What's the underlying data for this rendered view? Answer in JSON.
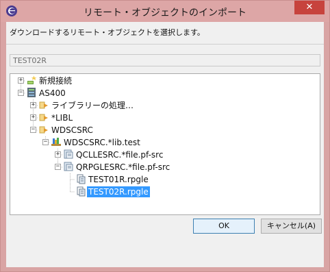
{
  "window": {
    "title": "リモート・オブジェクトのインポート",
    "close_glyph": "✕"
  },
  "dialog": {
    "instruction": "ダウンロードするリモート・オブジェクトを選択します。",
    "filter_value": "TEST02R"
  },
  "tree": {
    "new_connection": "新規接続",
    "system": "AS400",
    "library_handling": "ライブラリーの処理…",
    "libl": "*LIBL",
    "wdscsrc": "WDSCSRC",
    "lib_test": "WDSCSRC.*lib.test",
    "qcllesrc": "QCLLESRC.*file.pf-src",
    "qrpglesrc": "QRPGLESRC.*file.pf-src",
    "member1": "TEST01R.rpgle",
    "member2": "TEST02R.rpgle"
  },
  "buttons": {
    "ok": "OK",
    "cancel": "キャンセル(A)"
  },
  "colors": {
    "selection": "#3399ff",
    "close_button": "#c7433d"
  }
}
